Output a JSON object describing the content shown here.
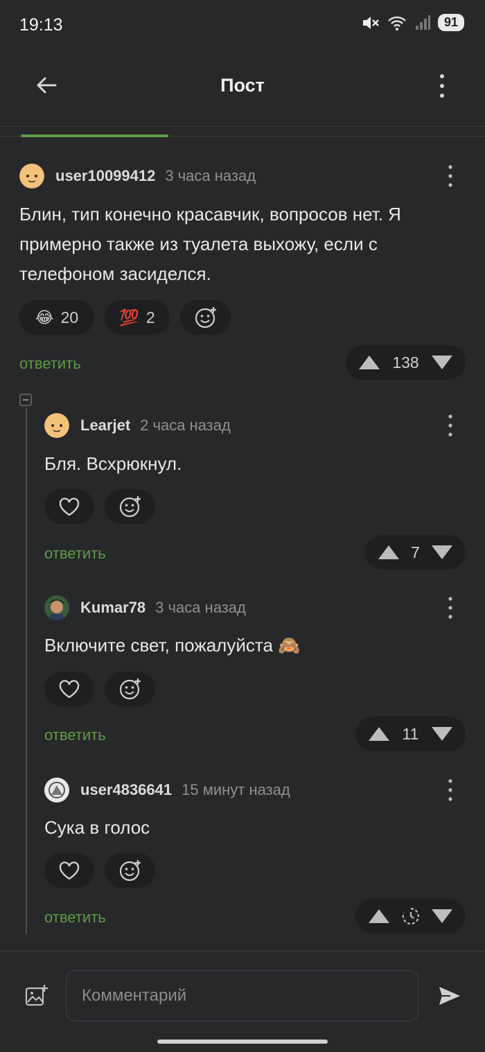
{
  "status": {
    "time": "19:13",
    "battery": "91"
  },
  "appbar": {
    "title": "Пост"
  },
  "comments": [
    {
      "user": "user10099412",
      "time": "3 часа назад",
      "text": "Блин, тип конечно красавчик, вопросов нет. Я примерно также из туалета выхожу, если с телефоном засиделся.",
      "reactions": [
        {
          "emoji": "😂",
          "count": "20"
        },
        {
          "emoji": "💯",
          "count": "2"
        }
      ],
      "reply_label": "ответить",
      "score": "138"
    },
    {
      "user": "Learjet",
      "time": "2 часа назад",
      "text": "Бля. Всхрюкнул.",
      "reply_label": "ответить",
      "score": "7"
    },
    {
      "user": "Kumar78",
      "time": "3 часа назад",
      "text": "Включите свет, пожалуйста 🙈",
      "reply_label": "ответить",
      "score": "11"
    },
    {
      "user": "user4836641",
      "time": "15 минут назад",
      "text": "Сука в голос",
      "reply_label": "ответить",
      "score": ""
    }
  ],
  "composer": {
    "placeholder": "Комментарий"
  },
  "icons": [
    "back-arrow-icon",
    "more-vert-icon",
    "heart-icon",
    "add-reaction-icon",
    "upvote-icon",
    "downvote-icon",
    "pending-clock-icon",
    "add-image-icon",
    "send-icon"
  ],
  "colors": {
    "accent": "#5e9b45",
    "background": "#27282a",
    "pill": "#1e1f21"
  }
}
